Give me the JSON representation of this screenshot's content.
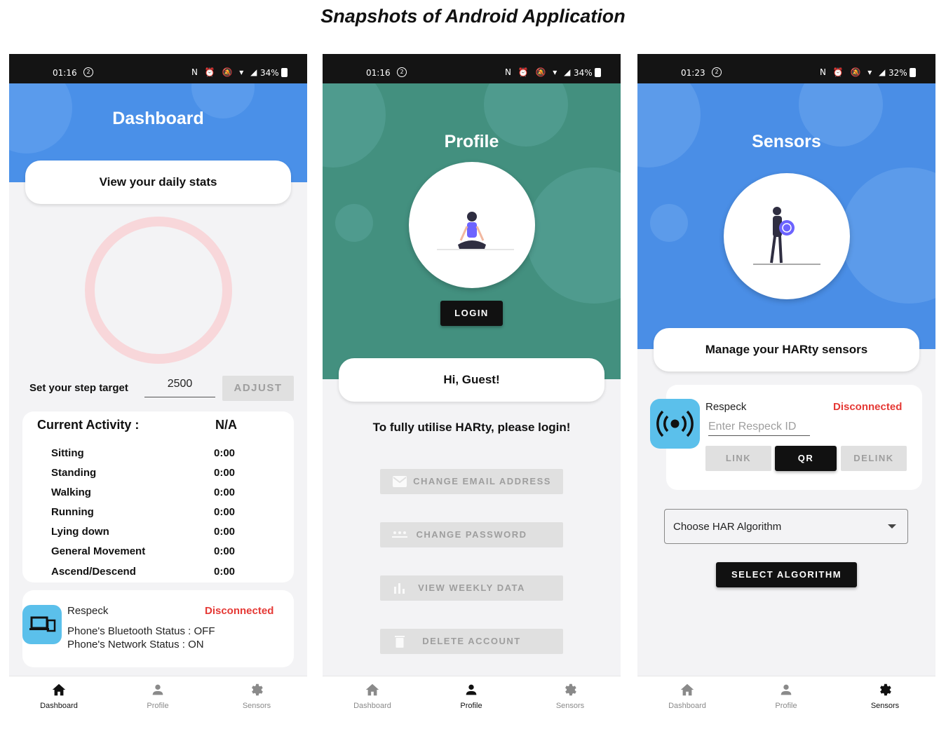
{
  "figure_title": "Snapshots of Android Application",
  "colors": {
    "dashboard_blue": "#4a90e8",
    "profile_teal": "#43907f",
    "sensors_blue": "#4a8ee6",
    "status_red": "#e53935",
    "device_icon_blue": "#5bc0eb"
  },
  "statusbar": [
    {
      "time": "01:16",
      "dnd": "2",
      "icons": "N ⏰ 🔕 ▾ ◢",
      "battery": "34%"
    },
    {
      "time": "01:16",
      "dnd": "2",
      "icons": "N ⏰ 🔕 ▾ ◢",
      "battery": "34%"
    },
    {
      "time": "01:23",
      "dnd": "2",
      "icons": "N ⏰ 🔕 ▾ ◢",
      "battery": "32%"
    }
  ],
  "nav": {
    "dashboard": "Dashboard",
    "profile": "Profile",
    "sensors": "Sensors"
  },
  "dashboard": {
    "title": "Dashboard",
    "card_title": "View your daily stats",
    "step_target_label": "Set your step target",
    "step_target_value": "2500",
    "adjust_button": "ADJUST",
    "current_activity_label": "Current Activity :",
    "current_activity_value": "N/A",
    "activities": [
      {
        "name": "Sitting",
        "time": "0:00"
      },
      {
        "name": "Standing",
        "time": "0:00"
      },
      {
        "name": "Walking",
        "time": "0:00"
      },
      {
        "name": "Running",
        "time": "0:00"
      },
      {
        "name": "Lying down",
        "time": "0:00"
      },
      {
        "name": "General Movement",
        "time": "0:00"
      },
      {
        "name": "Ascend/Descend",
        "time": "0:00"
      }
    ],
    "device": {
      "name": "Respeck",
      "status": "Disconnected",
      "bluetooth": "Phone's Bluetooth Status : OFF",
      "network": "Phone's Network Status : ON"
    }
  },
  "profile": {
    "title": "Profile",
    "login_button": "LOGIN",
    "greeting": "Hi, Guest!",
    "prompt": "To fully utilise HARty, please login!",
    "buttons": {
      "change_email": "CHANGE EMAIL ADDRESS",
      "change_password": "CHANGE PASSWORD",
      "weekly_data": "VIEW WEEKLY DATA",
      "delete_account": "DELETE ACCOUNT"
    }
  },
  "sensors": {
    "title": "Sensors",
    "card_title": "Manage your HARty sensors",
    "device_name": "Respeck",
    "device_status": "Disconnected",
    "id_placeholder": "Enter Respeck ID",
    "link_button": "LINK",
    "qr_button": "QR",
    "delink_button": "DELINK",
    "algorithm_select": "Choose HAR Algorithm",
    "select_button": "SELECT ALGORITHM"
  }
}
